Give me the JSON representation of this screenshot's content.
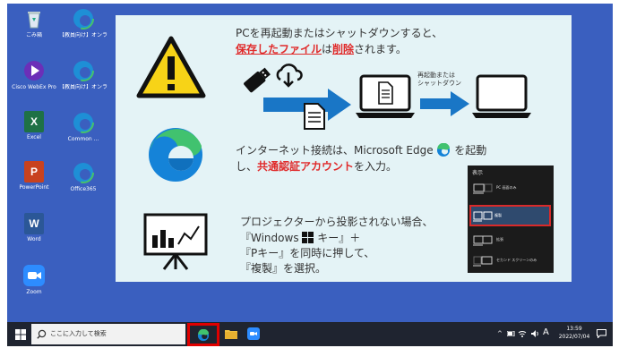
{
  "desktop": {
    "icons": [
      {
        "label": "ごみ箱",
        "icon": "recycle-bin-icon"
      },
      {
        "label": "【教員向け】オンライン授業Q&A",
        "icon": "edge-icon"
      },
      {
        "label": "Cisco WebEx Pro",
        "icon": "video-player-icon"
      },
      {
        "label": "【教員向け】オンライン授業サポート",
        "icon": "edge-icon"
      },
      {
        "label": "Excel",
        "icon": "excel-icon"
      },
      {
        "label": "Common ...",
        "icon": "edge-icon"
      },
      {
        "label": "PowerPoint",
        "icon": "powerpoint-icon"
      },
      {
        "label": "Office365",
        "icon": "edge-icon"
      },
      {
        "label": "Word",
        "icon": "word-icon"
      },
      {
        "label": "Zoom",
        "icon": "zoom-icon"
      }
    ]
  },
  "slide": {
    "section1": {
      "line1": "PCを再起動またはシャットダウンすると、",
      "saved_files": "保存したファイル",
      "wa": "は",
      "deleted": "削除",
      "rest": "されます。",
      "restart_label_1": "再起動または",
      "restart_label_2": "シャットダウン"
    },
    "section2": {
      "line1_a": "インターネット接続は、Microsoft Edge",
      "line1_b": "を起動",
      "line2_a": "し、",
      "shared_account": "共通認証アカウント",
      "line2_b": "を入力。"
    },
    "section3": {
      "line1": "プロジェクターから投影されない場合、",
      "line2_a": "『Windows",
      "line2_b": "キー』＋",
      "line3": "『Pキー』を同時に押して、",
      "line4": "『複製』を選択。"
    },
    "project_menu": {
      "title": "表示",
      "options": [
        "PC 画面のみ",
        "複製",
        "拡張",
        "セカンド スクリーンのみ"
      ],
      "selected_index": 1
    }
  },
  "taskbar": {
    "search_placeholder": "ここに入力して検索",
    "ime": "A",
    "time": "13:59",
    "date": "2022/07/04"
  },
  "colors": {
    "desktop": "#3a5fbf",
    "slide_bg": "#e4f3f6",
    "accent_red": "#e02a2a",
    "arrow_blue": "#1976c6",
    "taskbar": "#1f2430"
  }
}
